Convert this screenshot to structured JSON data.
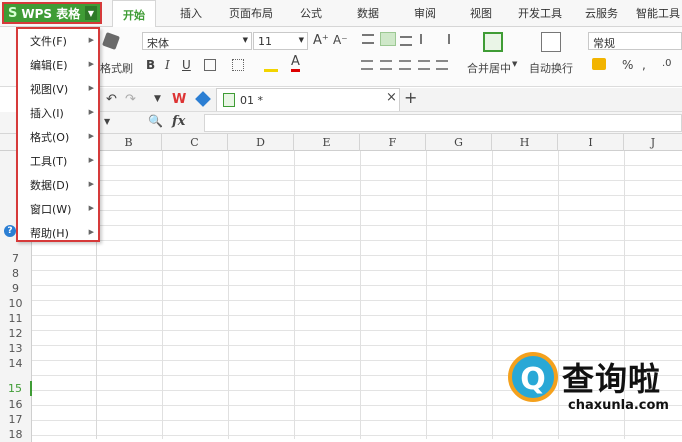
{
  "app": {
    "name": "WPS 表格",
    "logo_letter": "S"
  },
  "tabs": [
    "开始",
    "插入",
    "页面布局",
    "公式",
    "数据",
    "审阅",
    "视图",
    "开发工具",
    "云服务",
    "智能工具"
  ],
  "active_tab": "开始",
  "ribbon": {
    "format_painter": "格式刷",
    "font_name": "宋体",
    "font_size": "11",
    "merge_center": "合并居中",
    "wrap_text": "自动换行",
    "number_format": "常规",
    "percent": "%"
  },
  "document_tab": {
    "name": "01 *",
    "close": "×",
    "add": "+"
  },
  "formula_bar": {
    "fx": "fx",
    "value": ""
  },
  "columns": [
    "B",
    "C",
    "D",
    "E",
    "F",
    "G",
    "H",
    "I",
    "J"
  ],
  "rows": [
    "7",
    "8",
    "9",
    "10",
    "11",
    "12",
    "13",
    "14",
    "15",
    "16",
    "17",
    "18"
  ],
  "selected_row": "15",
  "menu": {
    "items": [
      "文件(F)",
      "编辑(E)",
      "视图(V)",
      "插入(I)",
      "格式(O)",
      "工具(T)",
      "数据(D)",
      "窗口(W)",
      "帮助(H)"
    ]
  },
  "watermark": {
    "name": "查询啦",
    "url": "chaxunla.com"
  },
  "colors": {
    "brand_green": "#3f9c35",
    "highlight_red": "#d63a3a"
  }
}
